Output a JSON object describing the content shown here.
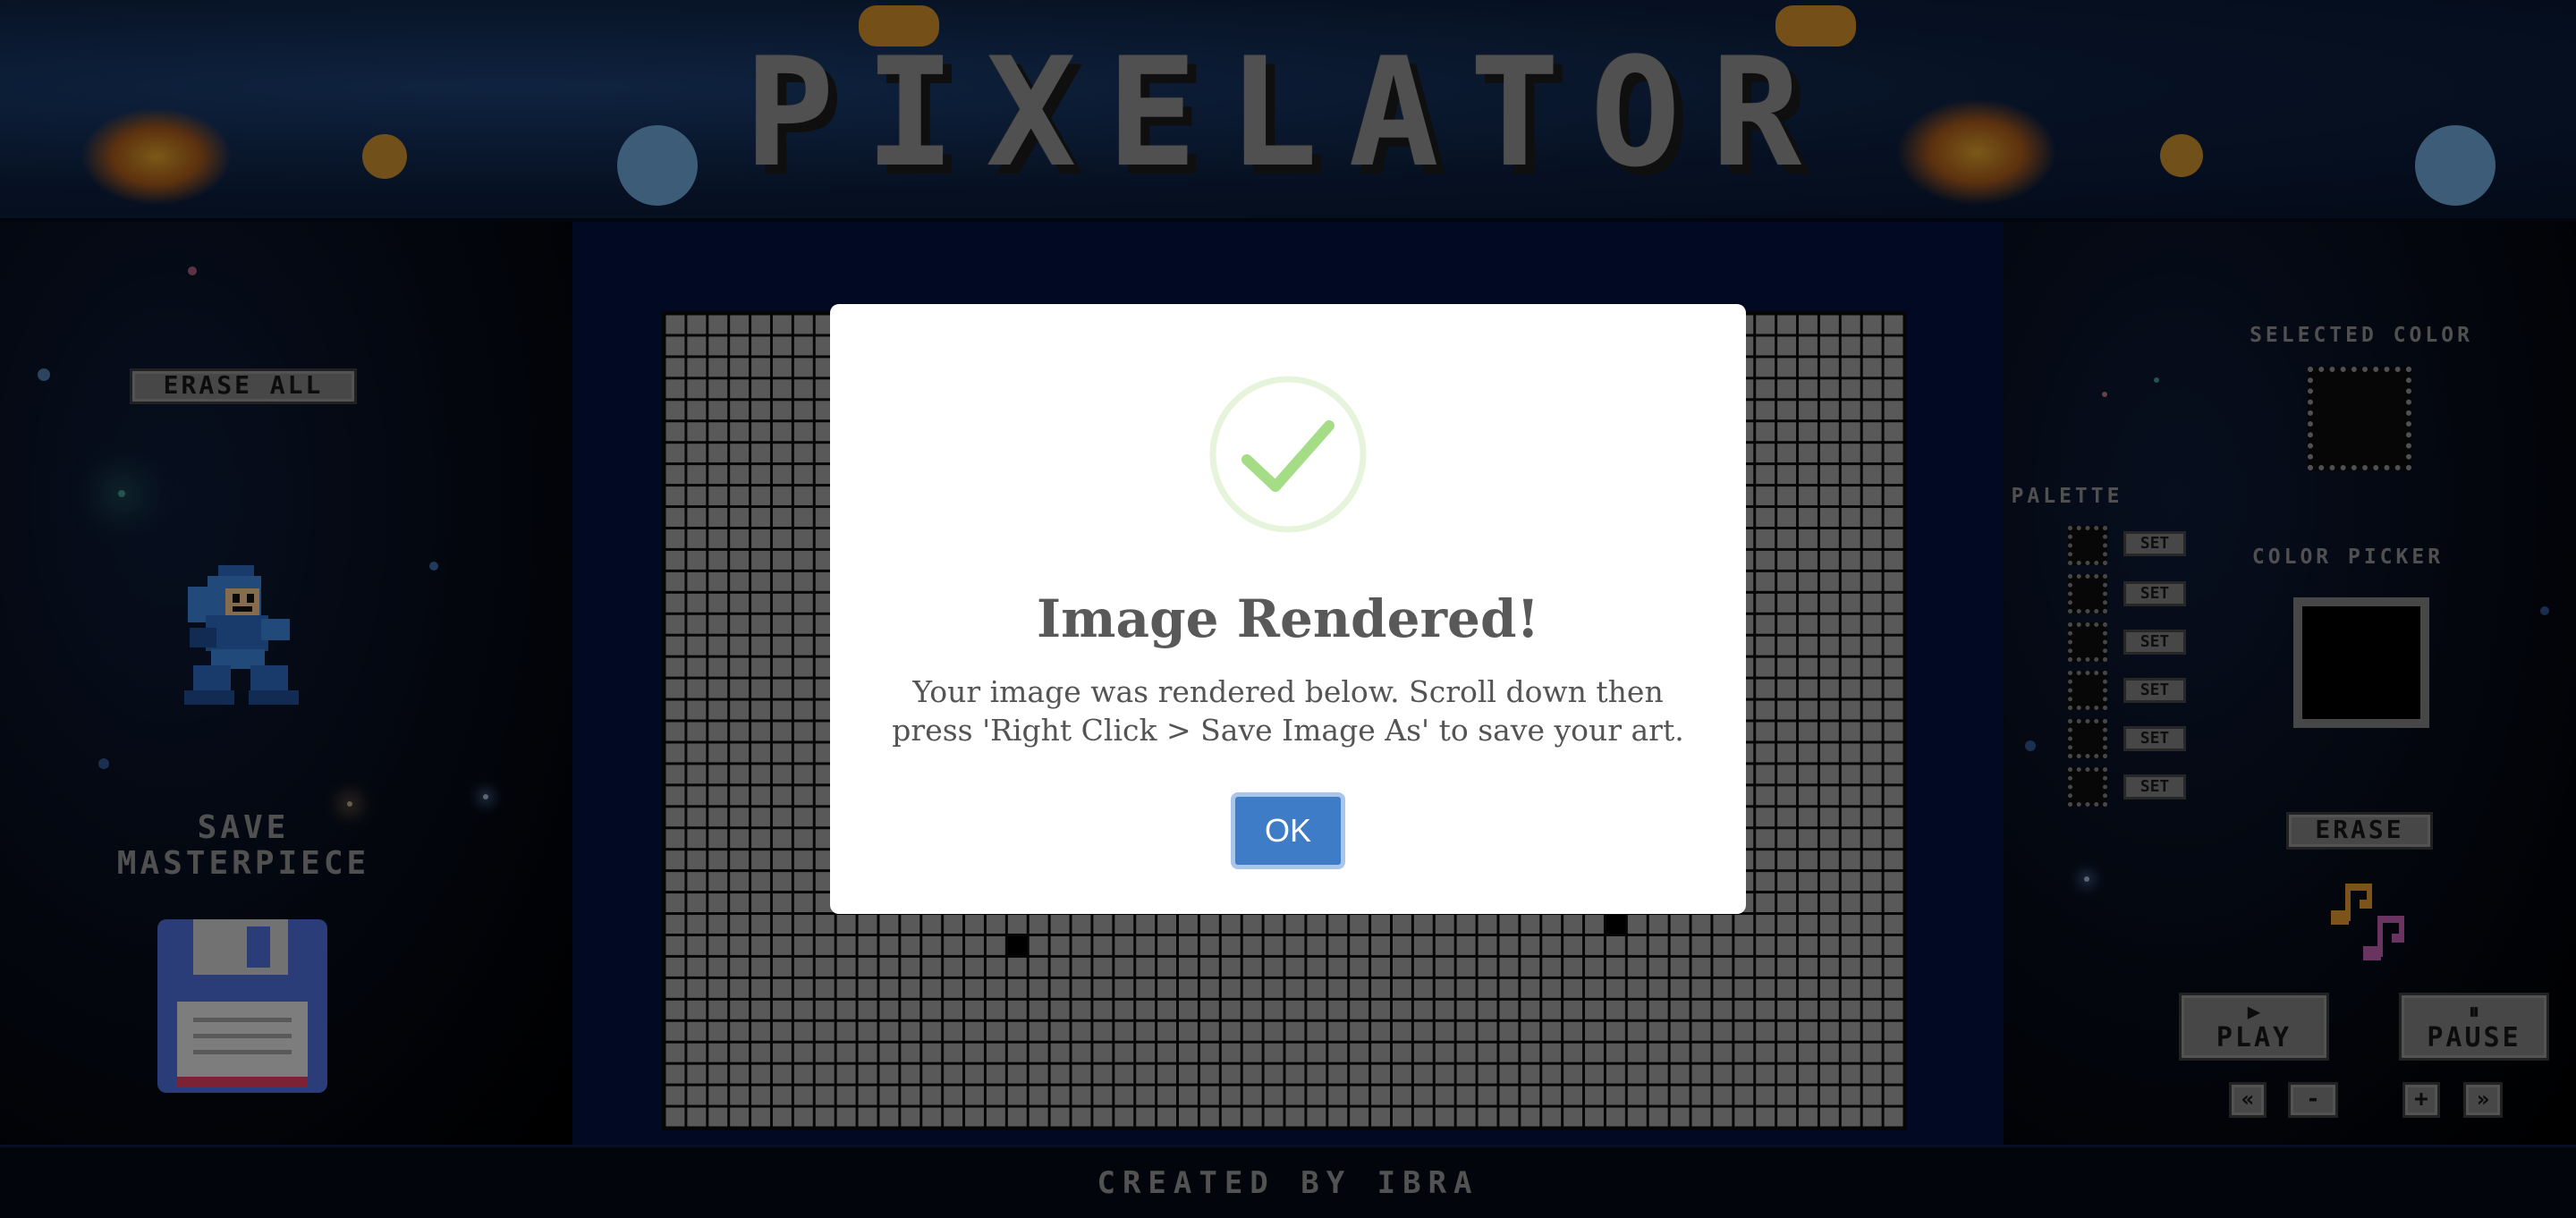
{
  "app": {
    "title": "PIXELATOR",
    "footer": "CREATED BY IBRA"
  },
  "left_panel": {
    "erase_all_label": "ERASE ALL",
    "save_label_line1": "SAVE",
    "save_label_line2": "MASTERPIECE",
    "character_icon": "megaman-sprite",
    "save_icon": "floppy-disk-icon"
  },
  "right_panel": {
    "selected_color_label": "SELECTED COLOR",
    "palette_label": "PALETTE",
    "palette_set_labels": [
      "SET",
      "SET",
      "SET",
      "SET",
      "SET",
      "SET"
    ],
    "color_picker_label": "COLOR PICKER",
    "erase_label": "ERASE",
    "music_icon": "music-notes-icon",
    "play_label": "PLAY",
    "pause_label": "PAUSE",
    "prev_label": "«",
    "vol_down_label": "-",
    "vol_up_label": "+",
    "next_label": "»"
  },
  "canvas": {
    "columns": 58,
    "rows": 38,
    "cell_color": "#9a9a9a",
    "grid_line_color": "#0b0b0b",
    "filled_cells": [
      {
        "col": 16,
        "row": 29,
        "color": "#000000"
      },
      {
        "col": 44,
        "row": 28,
        "color": "#000000"
      }
    ]
  },
  "modal": {
    "title": "Image Rendered!",
    "message": "Your image was rendered below. Scroll down then press 'Right Click > Save Image As' to save your art.",
    "ok_label": "OK",
    "icon": "success-check-icon",
    "accent_color": "#3f7cc7",
    "check_color": "#a5dc86"
  }
}
